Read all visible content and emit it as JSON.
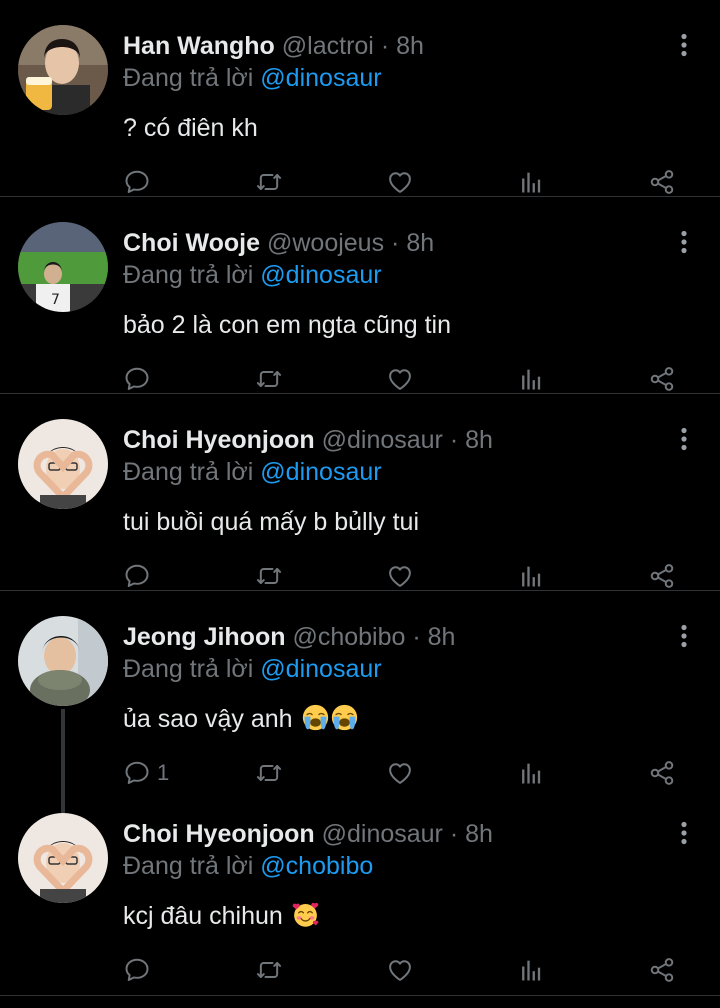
{
  "reply_prefix": "Đang trả lời",
  "colors": {
    "background": "#000000",
    "text": "#e7e9ea",
    "secondary": "#71767b",
    "mention": "#1d9bf0",
    "divider": "#2f3336"
  },
  "icons": [
    "more-vertical-icon",
    "reply-icon",
    "retweet-icon",
    "like-icon",
    "views-icon",
    "share-icon",
    "loudly-crying-face-emoji",
    "smiling-face-with-hearts-emoji"
  ],
  "tweets": [
    {
      "name": "Han Wangho",
      "handle": "@lactroi",
      "dot": "·",
      "time": "8h",
      "reply_to": "@dinosaur",
      "text": "? có điên kh",
      "reply_count": ""
    },
    {
      "name": "Choi Wooje",
      "handle": "@woojeus",
      "dot": "·",
      "time": "8h",
      "reply_to": "@dinosaur",
      "text": "bảo 2 là con em ngta cũng tin",
      "reply_count": ""
    },
    {
      "name": "Choi Hyeonjoon",
      "handle": "@dinosaur",
      "dot": "·",
      "time": "8h",
      "reply_to": "@dinosaur",
      "text": "tui buồi quá mấy b bủlly tui",
      "reply_count": ""
    },
    {
      "name": "Jeong Jihoon",
      "handle": "@chobibo",
      "dot": "·",
      "time": "8h",
      "reply_to": "@dinosaur",
      "text": "ủa sao vậy anh",
      "reply_count": "1"
    },
    {
      "name": "Choi Hyeonjoon",
      "handle": "@dinosaur",
      "dot": "·",
      "time": "8h",
      "reply_to": "@chobibo",
      "text": "kcj đâu chihun",
      "reply_count": ""
    }
  ]
}
